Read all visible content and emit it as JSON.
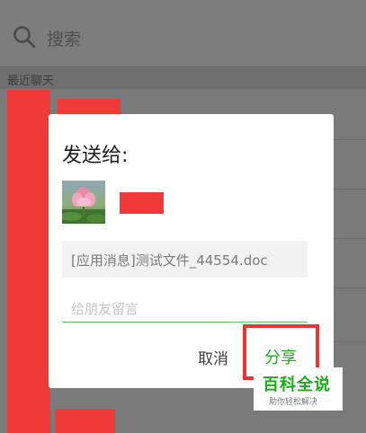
{
  "search": {
    "placeholder": "搜索"
  },
  "section": {
    "recent_chats_label": "最近聊天"
  },
  "dialog": {
    "title": "发送给:",
    "message_preview": "[应用消息]测试文件_44554.doc",
    "comment_placeholder": "给朋友留言",
    "cancel_label": "取消",
    "share_label": "分享"
  },
  "watermark": {
    "main": "百科全说",
    "sub": "助你轻松解决"
  },
  "colors": {
    "accent": "#1aad19",
    "highlight": "#ee3333",
    "redaction": "#f03a3a"
  }
}
